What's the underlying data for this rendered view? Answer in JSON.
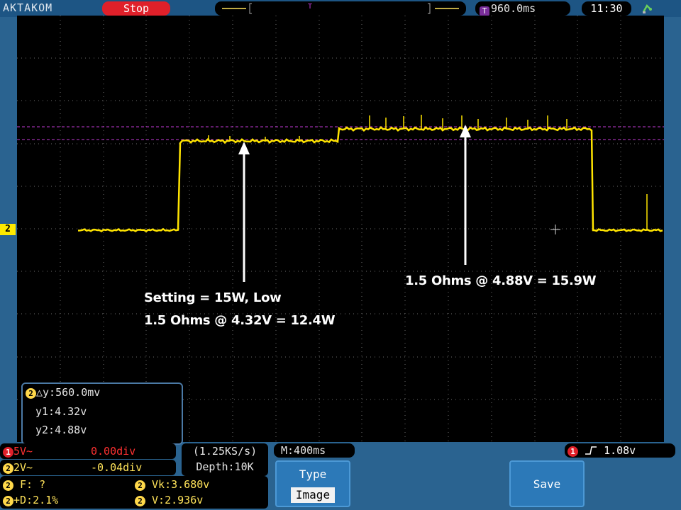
{
  "header": {
    "brand": "AKTAKOM",
    "run_state": "Stop",
    "trigger_marker": "T",
    "timebase_badge": "T",
    "timebase": "960.0ms",
    "time": "11:30",
    "usb_icon": "usb-icon"
  },
  "screen": {
    "channel_marker": "2",
    "annotations": {
      "left_line1": "Setting = 15W, Low",
      "left_line2": "1.5 Ohms @ 4.32V = 12.4W",
      "right_line1": "1.5 Ohms @ 4.88V = 15.9W"
    },
    "cursor_readout": {
      "channel": "2",
      "dy": "△y:560.0mv",
      "y1": "y1:4.32v",
      "y2": "y2:4.88v"
    },
    "colors": {
      "trace": "#ffe400",
      "cursor": "#c23ad6",
      "grid": "#6b6b6b"
    }
  },
  "channels": [
    {
      "num": "1",
      "scale": "5V~",
      "offset": "0.00div"
    },
    {
      "num": "2",
      "scale": "2V~",
      "offset": "-0.04div"
    }
  ],
  "acquisition": {
    "sample_rate": "(1.25KS/s)",
    "depth": "Depth:10K",
    "m_pos": "M:400ms"
  },
  "trigger": {
    "channel": "1",
    "level": "1.08v"
  },
  "measurements": {
    "channel": "2",
    "f": "F:  ?",
    "d": "+D:2.1%",
    "vk": "Vk:3.680v",
    "v": "V:2.936v"
  },
  "softkeys": {
    "type_label": "Type",
    "type_value": "Image",
    "save_label": "Save"
  }
}
